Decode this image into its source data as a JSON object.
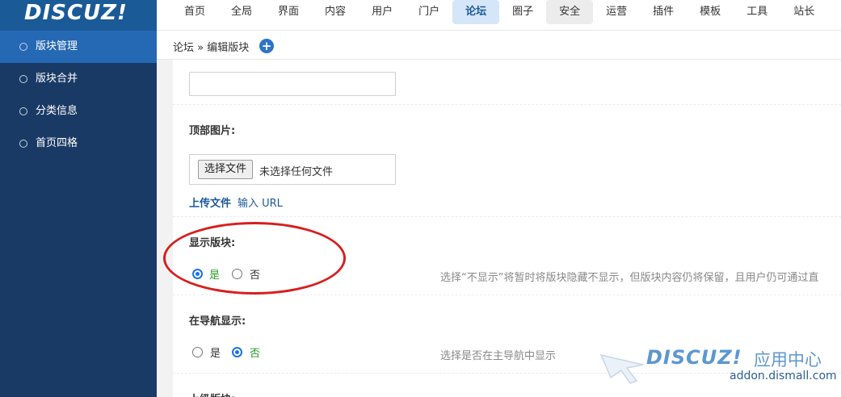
{
  "brand": {
    "logo_text": "DISCUZ!"
  },
  "nav": {
    "items": [
      "首页",
      "全局",
      "界面",
      "内容",
      "用户",
      "门户",
      "论坛",
      "圈子",
      "安全",
      "运营",
      "插件",
      "模板",
      "工具",
      "站长"
    ],
    "active": "论坛",
    "hovered": "安全"
  },
  "sidebar": {
    "items": [
      {
        "label": "版块管理",
        "active": true
      },
      {
        "label": "版块合并",
        "active": false
      },
      {
        "label": "分类信息",
        "active": false
      },
      {
        "label": "首页四格",
        "active": false
      }
    ]
  },
  "breadcrumb": {
    "text": "论坛 » 编辑版块",
    "add_symbol": "+"
  },
  "form": {
    "top_image": {
      "label": "顶部图片:",
      "file_button": "选择文件",
      "file_status": "未选择任何文件",
      "upload_link": "上传文件",
      "url_link": "输入 URL"
    },
    "show_forum": {
      "label": "显示版块:",
      "options": [
        "是",
        "否"
      ],
      "selected": "是",
      "hint": "选择“不显示”将暂时将版块隐藏不显示，但版块内容仍将保留，且用户仍可通过直"
    },
    "show_in_nav": {
      "label": "在导航显示:",
      "options": [
        "是",
        "否"
      ],
      "selected": "否",
      "hint": "选择是否在主导航中显示"
    },
    "parent_forum": {
      "label": "上级版块:"
    }
  },
  "watermark": {
    "brand": "DISCUZ!",
    "center": "应用中心",
    "url": "addon.dismall.com"
  },
  "colors": {
    "header_blue": "#1a5a97",
    "sidebar_bg": "#1a3a66",
    "sidebar_active": "#2568b4",
    "annotation_red": "#d81e1e",
    "selected_green": "#2a9a2a"
  }
}
